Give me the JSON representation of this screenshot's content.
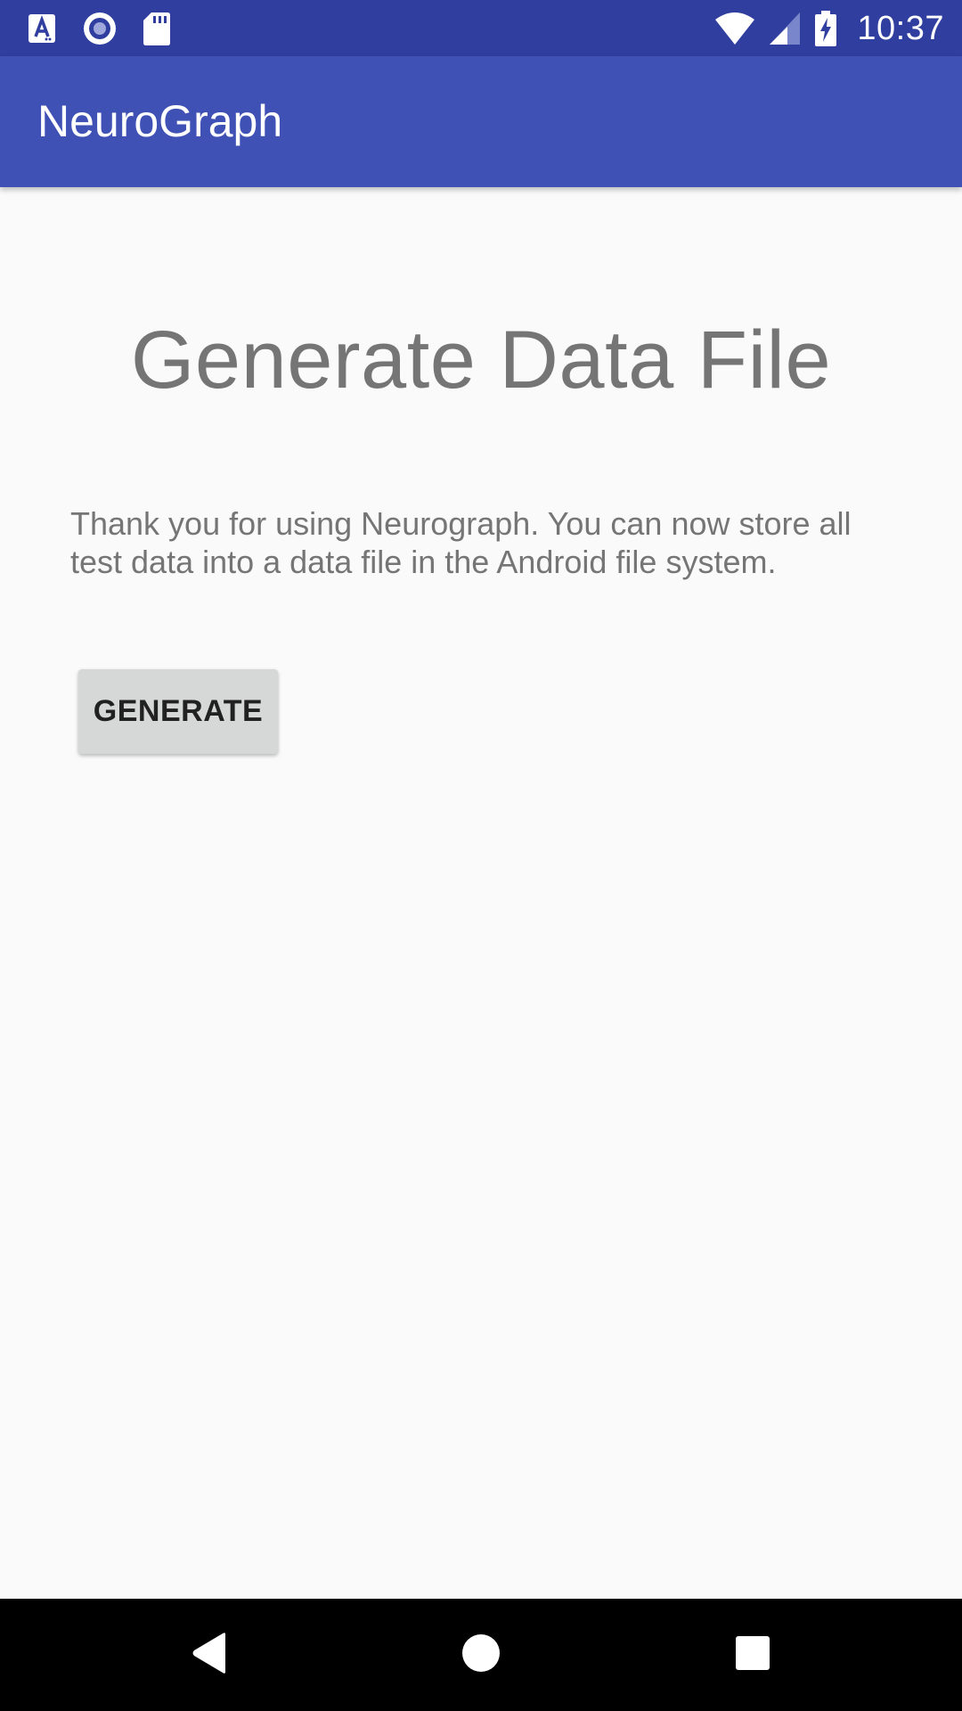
{
  "status_bar": {
    "time": "10:37",
    "left_icons": [
      "text-a-notification-icon",
      "radio-circle-notification-icon",
      "sd-card-icon"
    ],
    "right_icons": [
      "wifi-icon",
      "cell-signal-icon",
      "battery-charging-icon"
    ],
    "background_color": "#303f9f"
  },
  "app_bar": {
    "title": "NeuroGraph",
    "background_color": "#3f51b5"
  },
  "main": {
    "heading": "Generate Data File",
    "description": "Thank you for using Neurograph. You can now store all test data into a data file in the Android file system.",
    "generate_button_label": "GENERATE"
  },
  "nav_bar": {
    "buttons": [
      "back-icon",
      "home-icon",
      "recents-icon"
    ]
  }
}
